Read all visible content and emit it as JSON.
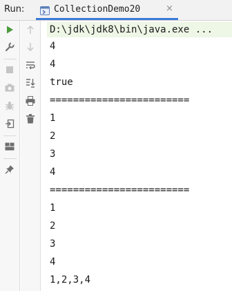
{
  "header": {
    "run_label": "Run:",
    "tab_label": "CollectionDemo20",
    "close_glyph": "×"
  },
  "toolbar": {
    "left": [
      {
        "name": "run-icon"
      },
      {
        "name": "wrench-icon"
      },
      {
        "name": "stop-icon"
      },
      {
        "name": "camera-icon"
      },
      {
        "name": "debug-icon"
      },
      {
        "name": "exit-icon"
      },
      {
        "name": "layout-icon"
      },
      {
        "name": "pin-icon"
      }
    ],
    "right": [
      {
        "name": "arrow-up-icon"
      },
      {
        "name": "arrow-down-icon"
      },
      {
        "name": "soft-wrap-icon"
      },
      {
        "name": "scroll-to-end-icon"
      },
      {
        "name": "print-icon"
      },
      {
        "name": "trash-icon"
      }
    ]
  },
  "colors": {
    "accent": "#3d7bd9",
    "run_green": "#4c9a3c",
    "command_bg": "#eef6e6"
  },
  "console": {
    "lines": [
      "D:\\jdk\\jdk8\\bin\\java.exe ...",
      "4",
      "4",
      "true",
      "========================",
      "1",
      "2",
      "3",
      "4",
      "========================",
      "1",
      "2",
      "3",
      "4",
      "1,2,3,4"
    ]
  }
}
